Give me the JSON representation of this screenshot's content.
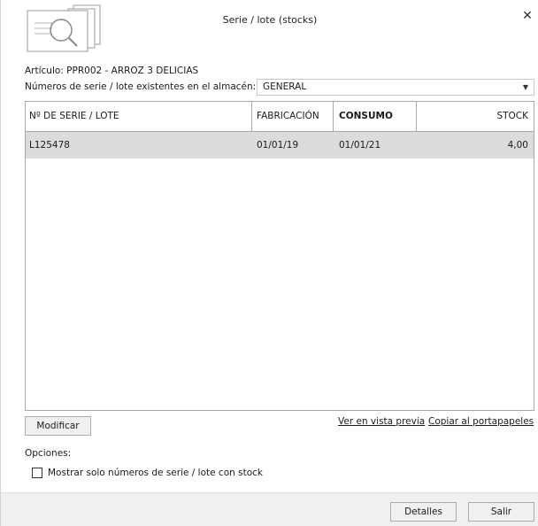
{
  "window": {
    "title": "Serie / lote (stocks)",
    "close_glyph": "✕"
  },
  "header_icon": "magnifier-documents-icon",
  "article": {
    "label": "Artículo: PPR002 - ARROZ 3 DELICIAS"
  },
  "warehouse": {
    "label": "Números de serie / lote existentes en el almacén:",
    "selected": "GENERAL",
    "arrow_glyph": "▼"
  },
  "grid": {
    "columns": [
      "Nº DE SERIE / LOTE",
      "FABRICACIÓN",
      "CONSUMO",
      "STOCK"
    ],
    "rows": [
      {
        "serie": "L125478",
        "fabricacion": "01/01/19",
        "consumo": "01/01/21",
        "stock": "4,00"
      }
    ]
  },
  "actions": {
    "modify": "Modificar",
    "preview": "Ver en vista previa",
    "copy": "Copiar al portapapeles"
  },
  "options": {
    "title": "Opciones:",
    "stock_only_label": "Mostrar solo números de serie / lote con stock",
    "stock_only_checked": false
  },
  "footer": {
    "details": "Detalles",
    "exit": "Salir"
  }
}
